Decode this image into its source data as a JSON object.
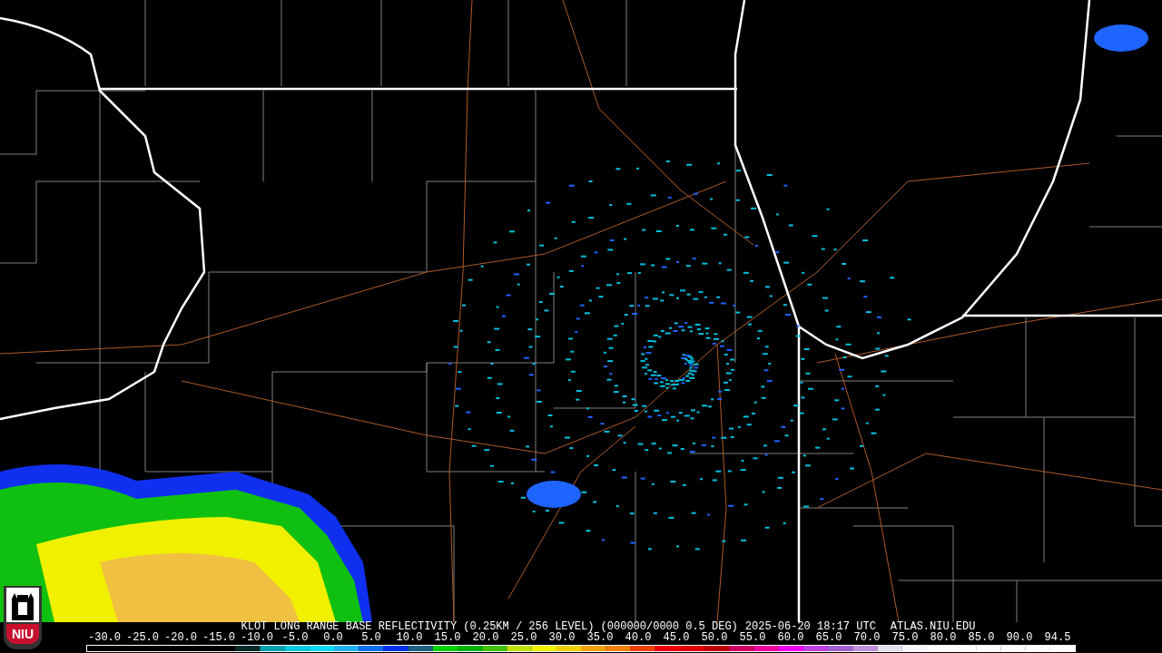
{
  "caption": {
    "product": "KLOT LONG RANGE BASE REFLECTIVITY (0.25KM / 256 LEVEL) (000000/0000 0.5 DEG)",
    "time": "2025-06-20 18:17 UTC",
    "site": "ATLAS.NIU.EDU"
  },
  "scale_labels": [
    "-30.0",
    "-25.0",
    "-20.0",
    "-15.0",
    "-10.0",
    "-5.0",
    "0.0",
    "5.0",
    "10.0",
    "15.0",
    "20.0",
    "25.0",
    "30.0",
    "35.0",
    "40.0",
    "45.0",
    "50.0",
    "55.0",
    "60.0",
    "65.0",
    "70.0",
    "75.0",
    "80.0",
    "85.0",
    "90.0",
    "94.5"
  ],
  "logo": {
    "text": "NIU"
  }
}
